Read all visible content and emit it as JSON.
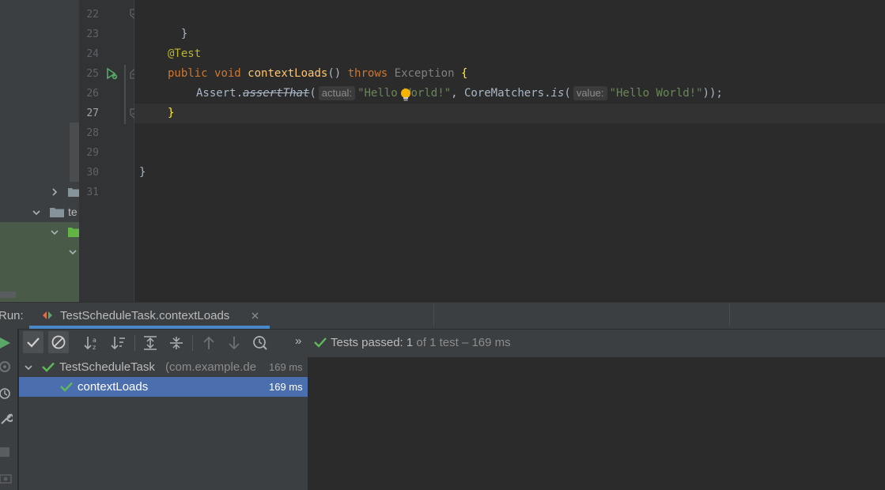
{
  "editor": {
    "lines": [
      {
        "num": "22",
        "current": false
      },
      {
        "num": "23",
        "current": false
      },
      {
        "num": "24",
        "current": false
      },
      {
        "num": "25",
        "current": false
      },
      {
        "num": "26",
        "current": false
      },
      {
        "num": "27",
        "current": true
      },
      {
        "num": "28",
        "current": false
      },
      {
        "num": "29",
        "current": false
      },
      {
        "num": "30",
        "current": false
      },
      {
        "num": "31",
        "current": false
      }
    ],
    "code": {
      "close_brace_22": "}",
      "annotation": "@Test",
      "public_kw": "public",
      "void_kw": "void",
      "method_name": "contextLoads",
      "parens": "()",
      "throws_kw": "throws",
      "exception_type": "Exception",
      "open_brace": "{",
      "assert_class": "Assert.",
      "assert_method": "assertThat",
      "open_paren": "(",
      "hint_actual": "actual:",
      "str1": "\"Hello World!\"",
      "comma": ",",
      "matchers_class": "CoreMatchers.",
      "is_method": "is",
      "hint_value": "value:",
      "str2": "\"Hello World!\"",
      "closing": "));",
      "close_brace_27": "}",
      "close_brace_30": "}"
    }
  },
  "project_tree": {
    "folder_label": "te"
  },
  "run": {
    "label": "Run:",
    "tab_title": "TestScheduleTask.contextLoads",
    "status_prefix": "Tests passed:",
    "status_count": "1",
    "status_suffix": "of 1 test – 169 ms",
    "more_chevron": "»",
    "tree": [
      {
        "name": "TestScheduleTask",
        "package": "(com.example.de",
        "time": "169 ms"
      },
      {
        "name": "contextLoads",
        "time": "169 ms",
        "selected": true
      }
    ]
  },
  "colors": {
    "pass_green": "#5fb85a",
    "selection_blue": "#4b6eaf",
    "tab_underline": "#4a88c7"
  }
}
